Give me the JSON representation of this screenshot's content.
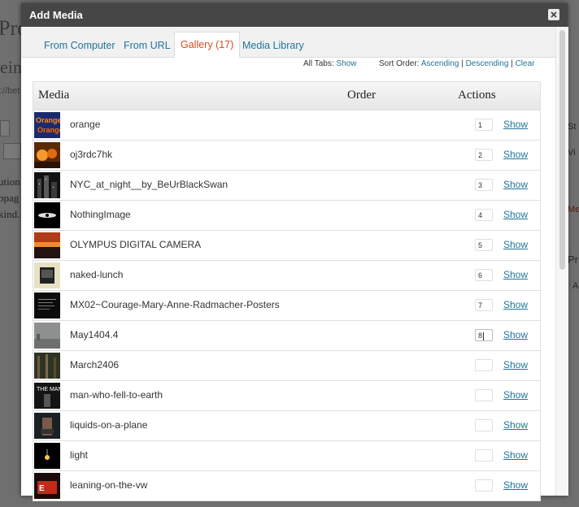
{
  "background": {
    "title_fragment": "Pro",
    "heading_fragment": "eing",
    "url_fragment": "://bet",
    "line1": "ution",
    "line2": "bpag",
    "line3": "kind.",
    "right_fragments": [
      "St",
      "Vi",
      "Me",
      "Pr",
      "A"
    ]
  },
  "modal": {
    "title": "Add Media",
    "close_icon": "close-x-icon",
    "tabs": [
      {
        "label": "From Computer",
        "active": false
      },
      {
        "label": "From URL",
        "active": false
      },
      {
        "label": "Gallery (17)",
        "active": true
      },
      {
        "label": "Media Library",
        "active": false
      }
    ],
    "all_tabs_label": "All Tabs:",
    "all_tabs_show": "Show",
    "sort_order_label": "Sort Order:",
    "sort_ascending": "Ascending",
    "sort_separator": "|",
    "sort_descending": "Descending",
    "sort_clear": "Clear"
  },
  "table": {
    "headers": {
      "media": "Media",
      "order": "Order",
      "actions": "Actions"
    },
    "show_label": "Show",
    "rows": [
      {
        "title": "orange",
        "order": "1",
        "thumb": "orange"
      },
      {
        "title": "oj3rdc7hk",
        "order": "2",
        "thumb": "fire"
      },
      {
        "title": "NYC_at_night__by_BeUrBlackSwan",
        "order": "3",
        "thumb": "city"
      },
      {
        "title": "NothingImage",
        "order": "4",
        "thumb": "eye"
      },
      {
        "title": "OLYMPUS DIGITAL CAMERA",
        "order": "5",
        "thumb": "sunset"
      },
      {
        "title": "naked-lunch",
        "order": "6",
        "thumb": "book"
      },
      {
        "title": "MX02~Courage-Mary-Anne-Radmacher-Posters",
        "order": "7",
        "thumb": "poster"
      },
      {
        "title": "May1404.4",
        "order": "8",
        "thumb": "fog"
      },
      {
        "title": "March2406",
        "order": "",
        "thumb": "forest"
      },
      {
        "title": "man-who-fell-to-earth",
        "order": "",
        "thumb": "man"
      },
      {
        "title": "liquids-on-a-plane",
        "order": "",
        "thumb": "plane"
      },
      {
        "title": "light",
        "order": "",
        "thumb": "bulb"
      },
      {
        "title": "leaning-on-the-vw",
        "order": "",
        "thumb": "vw"
      }
    ]
  },
  "colors": {
    "link": "#21759b",
    "active_tab": "#d54e21",
    "titlebar": "#464646"
  }
}
